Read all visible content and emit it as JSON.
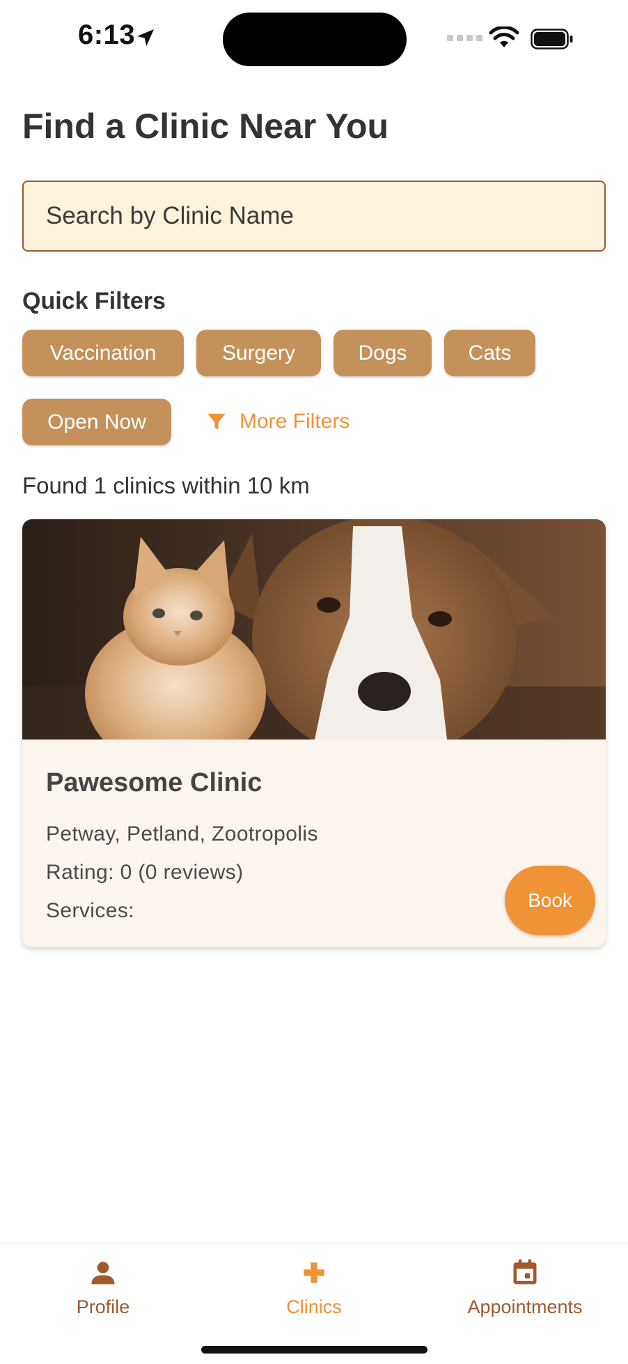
{
  "status_bar": {
    "time": "6:13"
  },
  "page": {
    "title": "Find a Clinic Near You"
  },
  "search": {
    "placeholder": "Search by Clinic Name"
  },
  "filters": {
    "title": "Quick Filters",
    "chips": [
      "Vaccination",
      "Surgery",
      "Dogs",
      "Cats",
      "Open Now"
    ],
    "more_label": "More Filters"
  },
  "results": {
    "summary": "Found 1 clinics within 10 km"
  },
  "clinic": {
    "name": "Pawesome Clinic",
    "address": "Petway, Petland, Zootropolis",
    "rating": "Rating: 0 (0 reviews)",
    "services": "Services:",
    "book_label": "Book",
    "image": "kitten-and-dog-photo"
  },
  "tabbar": {
    "items": [
      {
        "label": "Profile",
        "icon": "person-icon"
      },
      {
        "label": "Clinics",
        "icon": "plus-icon",
        "active": true
      },
      {
        "label": "Appointments",
        "icon": "calendar-icon"
      }
    ]
  },
  "colors": {
    "chip": "#c4915b",
    "accent": "#f09236",
    "brown": "#a05a2e",
    "search_bg": "#fdf3dd",
    "card_bg": "#fbf5ee"
  }
}
